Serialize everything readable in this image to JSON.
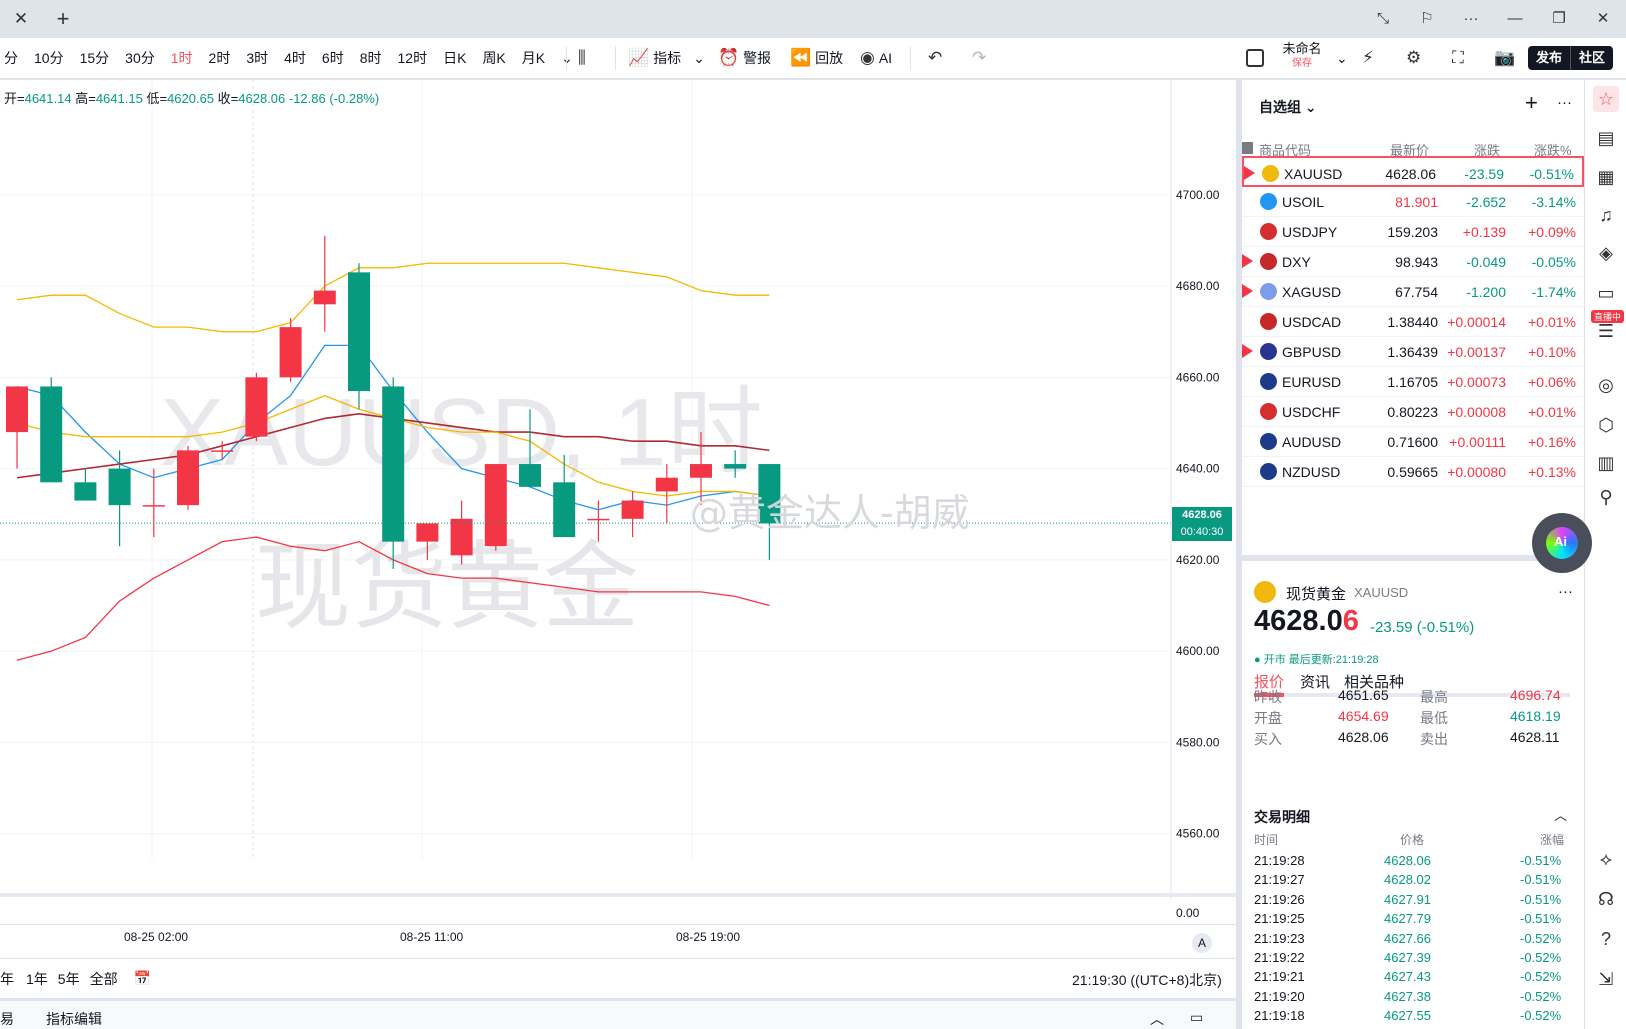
{
  "titlebar": {
    "close_glyph": "✕",
    "plus_glyph": "+",
    "controls": [
      "⤡",
      "⚐",
      "···",
      "—",
      "❐",
      "✕"
    ]
  },
  "toolbar": {
    "intervals": [
      "分",
      "10分",
      "15分",
      "30分",
      "1时",
      "2时",
      "3时",
      "4时",
      "6时",
      "8时",
      "12时",
      "日K",
      "周K",
      "月K"
    ],
    "active_interval": "1时",
    "indicators_label": "指标",
    "alert_label": "警报",
    "replay_label": "回放",
    "ai_label": "AI",
    "layout_name": "未命名",
    "layout_status": "保存",
    "publish_label": "发布",
    "community_label": "社区"
  },
  "chart": {
    "ohlc": {
      "open_label": "开=",
      "open": "4641.14",
      "high_label": "高=",
      "high": "4641.15",
      "low_label": "低=",
      "low": "4620.65",
      "close_label": "收=",
      "close": "4628.06",
      "change": "-12.86 (-0.28%)"
    },
    "watermark_symbol": "XAUUSD, 1时",
    "watermark_name": "现货黄金",
    "overlay_credit": "@黄金达人-胡威",
    "price_ticks": [
      "4700.00",
      "4680.00",
      "4660.00",
      "4640.00",
      "4620.00",
      "4600.00",
      "4580.00",
      "4560.00"
    ],
    "sub_tick": "0.00",
    "last_price": "4628.06",
    "countdown": "00:40:30",
    "time_ticks": [
      "08-25 02:00",
      "08-25 11:00",
      "08-25 19:00"
    ],
    "auto_label": "A"
  },
  "chart_data": {
    "type": "candlestick",
    "ylim": [
      4556,
      4712
    ],
    "candles": [
      {
        "o": 4648,
        "h": 4654,
        "l": 4640,
        "c": 4658
      },
      {
        "o": 4658,
        "h": 4660,
        "l": 4640,
        "c": 4637
      },
      {
        "o": 4637,
        "h": 4640,
        "l": 4633,
        "c": 4633
      },
      {
        "o": 4640,
        "h": 4644,
        "l": 4623,
        "c": 4632
      },
      {
        "o": 4632,
        "h": 4640,
        "l": 4625,
        "c": 4632
      },
      {
        "o": 4632,
        "h": 4645,
        "l": 4631,
        "c": 4644
      },
      {
        "o": 4644,
        "h": 4646,
        "l": 4642,
        "c": 4644
      },
      {
        "o": 4647,
        "h": 4661,
        "l": 4646,
        "c": 4660
      },
      {
        "o": 4660,
        "h": 4673,
        "l": 4659,
        "c": 4671
      },
      {
        "o": 4676,
        "h": 4691,
        "l": 4670,
        "c": 4679
      },
      {
        "o": 4683,
        "h": 4685,
        "l": 4653,
        "c": 4657
      },
      {
        "o": 4658,
        "h": 4660,
        "l": 4618,
        "c": 4624
      },
      {
        "o": 4624,
        "h": 4628,
        "l": 4620,
        "c": 4628
      },
      {
        "o": 4621,
        "h": 4633,
        "l": 4619,
        "c": 4629
      },
      {
        "o": 4623,
        "h": 4641,
        "l": 4622,
        "c": 4641
      },
      {
        "o": 4641,
        "h": 4653,
        "l": 4637,
        "c": 4636
      },
      {
        "o": 4637,
        "h": 4643,
        "l": 4625,
        "c": 4625
      },
      {
        "o": 4629,
        "h": 4633,
        "l": 4624,
        "c": 4629
      },
      {
        "o": 4629,
        "h": 4635,
        "l": 4625,
        "c": 4633
      },
      {
        "o": 4635,
        "h": 4641,
        "l": 4628,
        "c": 4638
      },
      {
        "o": 4638,
        "h": 4648,
        "l": 4632,
        "c": 4641
      },
      {
        "o": 4641,
        "h": 4644,
        "l": 4638,
        "c": 4640
      },
      {
        "o": 4641,
        "h": 4641,
        "l": 4620,
        "c": 4628
      }
    ],
    "series": [
      {
        "color": "#f5b800",
        "values": [
          4677,
          4678,
          4678,
          4674,
          4671,
          4671,
          4670,
          4670,
          4672,
          4680,
          4684,
          4684,
          4685,
          4685,
          4685,
          4685,
          4685,
          4684,
          4683,
          4682,
          4679,
          4678,
          4678
        ]
      },
      {
        "color": "#f23645",
        "values": [
          4598,
          4600,
          4603,
          4611,
          4616,
          4620,
          4624,
          4625,
          4623,
          4622,
          4624,
          4620,
          4617,
          4616,
          4616,
          4615,
          4614,
          4613,
          4613,
          4613,
          4613,
          4612,
          4610
        ]
      },
      {
        "color": "#2196f3",
        "values": [
          4658,
          4656,
          4648,
          4641,
          4638,
          4640,
          4642,
          4650,
          4656,
          4667,
          4667,
          4657,
          4648,
          4640,
          4638,
          4636,
          4633,
          4631,
          4633,
          4632,
          4634,
          4635,
          4634
        ]
      },
      {
        "color": "#b22833",
        "values": [
          4638,
          4639,
          4640,
          4641,
          4642,
          4643,
          4645,
          4647,
          4649,
          4651,
          4652,
          4651,
          4650,
          4649,
          4648,
          4648,
          4647,
          4647,
          4646,
          4646,
          4645,
          4645,
          4644
        ]
      },
      {
        "color": "#f5b800",
        "values": [
          4650,
          4648,
          4647,
          4647,
          4647,
          4647,
          4648,
          4650,
          4653,
          4656,
          4653,
          4651,
          4649,
          4648,
          4648,
          4646,
          4641,
          4637,
          4635,
          4634,
          4635,
          4635,
          4634
        ]
      }
    ]
  },
  "range_bar": {
    "ranges": [
      "年",
      "1年",
      "5年",
      "全部"
    ],
    "clock": "21:19:30 ((UTC+8)北京)"
  },
  "bottom_bar": {
    "trade_tab": "易",
    "indicator_edit": "指标编辑"
  },
  "watchlist": {
    "title": "自选组",
    "add_glyph": "+",
    "more_glyph": "···",
    "columns": [
      "商品代码",
      "最新价",
      "涨跌",
      "涨跌%"
    ],
    "rows": [
      {
        "sym": "XAUUSD",
        "last": "4628.06",
        "chg": "-23.59",
        "pct": "-0.51%",
        "dir": "dn",
        "last_dir": "nt",
        "flag": true,
        "icon_color": "#f0b90b",
        "selected": true
      },
      {
        "sym": "USOIL",
        "last": "81.901",
        "chg": "-2.652",
        "pct": "-3.14%",
        "dir": "dn",
        "last_dir": "up",
        "flag": false,
        "icon_color": "#2196f3"
      },
      {
        "sym": "USDJPY",
        "last": "159.203",
        "chg": "+0.139",
        "pct": "+0.09%",
        "dir": "up",
        "last_dir": "nt",
        "flag": false,
        "icon_color": "#d32f2f"
      },
      {
        "sym": "DXY",
        "last": "98.943",
        "chg": "-0.049",
        "pct": "-0.05%",
        "dir": "dn",
        "last_dir": "nt",
        "flag": true,
        "icon_color": "#c62828"
      },
      {
        "sym": "XAGUSD",
        "last": "67.754",
        "chg": "-1.200",
        "pct": "-1.74%",
        "dir": "dn",
        "last_dir": "nt",
        "flag": true,
        "icon_color": "#7e9ce8"
      },
      {
        "sym": "USDCAD",
        "last": "1.38440",
        "chg": "+0.00014",
        "pct": "+0.01%",
        "dir": "up",
        "last_dir": "nt",
        "flag": false,
        "icon_color": "#c62828"
      },
      {
        "sym": "GBPUSD",
        "last": "1.36439",
        "chg": "+0.00137",
        "pct": "+0.10%",
        "dir": "up",
        "last_dir": "nt",
        "flag": true,
        "icon_color": "#283593"
      },
      {
        "sym": "EURUSD",
        "last": "1.16705",
        "chg": "+0.00073",
        "pct": "+0.06%",
        "dir": "up",
        "last_dir": "nt",
        "flag": false,
        "icon_color": "#1e3a8a"
      },
      {
        "sym": "USDCHF",
        "last": "0.80223",
        "chg": "+0.00008",
        "pct": "+0.01%",
        "dir": "up",
        "last_dir": "nt",
        "flag": false,
        "icon_color": "#d32f2f"
      },
      {
        "sym": "AUDUSD",
        "last": "0.71600",
        "chg": "+0.00111",
        "pct": "+0.16%",
        "dir": "up",
        "last_dir": "nt",
        "flag": false,
        "icon_color": "#1e3a8a"
      },
      {
        "sym": "NZDUSD",
        "last": "0.59665",
        "chg": "+0.00080",
        "pct": "+0.13%",
        "dir": "up",
        "last_dir": "nt",
        "flag": false,
        "icon_color": "#1e3a8a"
      }
    ]
  },
  "details": {
    "name": "现货黄金",
    "symbol": "XAUUSD",
    "more_glyph": "···",
    "price_main": "4628.0",
    "price_last_digit": "6",
    "change": "-23.59 (-0.51%)",
    "status": "● 开市 最后更新:21:19:28",
    "tabs": [
      "报价",
      "资讯",
      "相关品种"
    ],
    "quotes": [
      {
        "label": "昨收",
        "value": "4651.65",
        "dir": "nt",
        "label2": "最高",
        "value2": "4696.74",
        "dir2": "up"
      },
      {
        "label": "开盘",
        "value": "4654.69",
        "dir": "up",
        "label2": "最低",
        "value2": "4618.19",
        "dir2": "dn"
      },
      {
        "label": "买入",
        "value": "4628.06",
        "dir": "nt",
        "label2": "卖出",
        "value2": "4628.11",
        "dir2": "nt"
      }
    ],
    "trades_title": "交易明细",
    "trades_chevron": "︿",
    "trades_cols": [
      "时间",
      "价格",
      "涨幅"
    ],
    "trades": [
      {
        "time": "21:19:28",
        "price": "4628.06",
        "pct": "-0.51%"
      },
      {
        "time": "21:19:27",
        "price": "4628.02",
        "pct": "-0.51%"
      },
      {
        "time": "21:19:26",
        "price": "4627.91",
        "pct": "-0.51%"
      },
      {
        "time": "21:19:25",
        "price": "4627.79",
        "pct": "-0.51%"
      },
      {
        "time": "21:19:23",
        "price": "4627.66",
        "pct": "-0.52%"
      },
      {
        "time": "21:19:22",
        "price": "4627.39",
        "pct": "-0.52%"
      },
      {
        "time": "21:19:21",
        "price": "4627.43",
        "pct": "-0.52%"
      },
      {
        "time": "21:19:20",
        "price": "4627.38",
        "pct": "-0.52%"
      },
      {
        "time": "21:19:18",
        "price": "4627.55",
        "pct": "-0.52%"
      }
    ]
  },
  "right_rail": {
    "icons": [
      "☆",
      "▤",
      "▦",
      "♫",
      "◈",
      "▭",
      "☰",
      "◎",
      "⬡",
      "▥",
      "⚲",
      "⟡",
      "☊",
      "?",
      "⇲"
    ],
    "live_badge": "直播中"
  },
  "ai_bubble": {
    "label": "Ai"
  }
}
